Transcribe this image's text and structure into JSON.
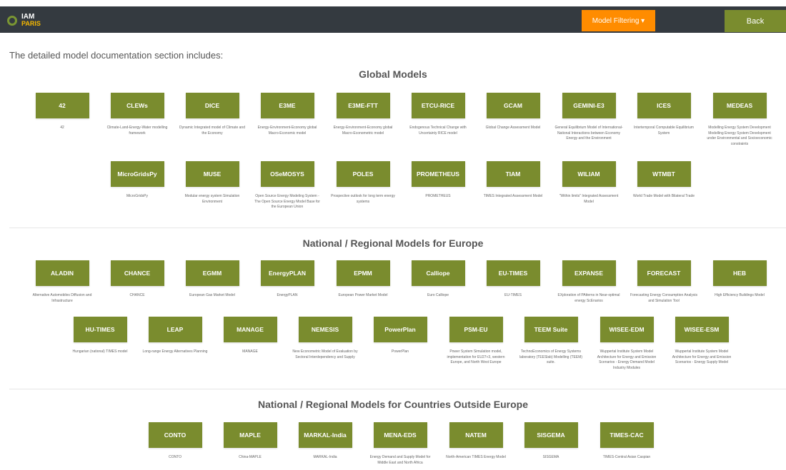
{
  "header": {
    "logo_line1": "IAM",
    "logo_line2": "PARIS",
    "filter_label": "Model Filtering ▾",
    "back_label": "Back"
  },
  "intro": "The detailed model documentation section includes:",
  "sections": [
    {
      "title": "Global Models",
      "models": [
        {
          "name": "42",
          "desc": "42"
        },
        {
          "name": "CLEWs",
          "desc": "Climate-Land-Energy-Water modelling framework"
        },
        {
          "name": "DICE",
          "desc": "Dynamic Integrated model of Climate and the Economy"
        },
        {
          "name": "E3ME",
          "desc": "Energy-Environment-Economy global Macro-Economic model"
        },
        {
          "name": "E3ME-FTT",
          "desc": "Energy-Environment-Economy global Macro-Econometric model"
        },
        {
          "name": "ETCU-RICE",
          "desc": "Endogenous Technical Change with Uncertainty RICE model"
        },
        {
          "name": "GCAM",
          "desc": "Global Change Assessment Model"
        },
        {
          "name": "GEMINI-E3",
          "desc": "General Equilibrium Model of International-National Interactions between Economy Energy and the Environment"
        },
        {
          "name": "ICES",
          "desc": "Intertemporal Computable Equilibrium System"
        },
        {
          "name": "MEDEAS",
          "desc": "Modelling Energy System Development Modelling Energy System Development under Environmental and Socioeconomic constraints"
        },
        {
          "name": "MicroGridsPy",
          "desc": "MicroGridsPy"
        },
        {
          "name": "MUSE",
          "desc": "Modular energy system Simulation Environment"
        },
        {
          "name": "OSeMOSYS",
          "desc": "Open Source Energy Modeling System - The Open Source Energy Model Base for the European Union"
        },
        {
          "name": "POLES",
          "desc": "Prospective outlook for long term energy systems"
        },
        {
          "name": "PROMETHEUS",
          "desc": "PROMETHEUS"
        },
        {
          "name": "TIAM",
          "desc": "TIMES Integrated Assessment Model"
        },
        {
          "name": "WILIAM",
          "desc": "\"Within limits\" Integrated Assessment Model"
        },
        {
          "name": "WTMBT",
          "desc": "World Trade Model with Bilateral Trade"
        }
      ]
    },
    {
      "title": "National / Regional Models for Europe",
      "models": [
        {
          "name": "ALADIN",
          "desc": "Alternative Automobiles Diffusion and Infrastructure"
        },
        {
          "name": "CHANCE",
          "desc": "CHANCE"
        },
        {
          "name": "EGMM",
          "desc": "European Gas Market Model"
        },
        {
          "name": "EnergyPLAN",
          "desc": "EnergyPLAN"
        },
        {
          "name": "EPMM",
          "desc": "European Power Market Model"
        },
        {
          "name": "Calliope",
          "desc": "Euro Calliope"
        },
        {
          "name": "EU-TIMES",
          "desc": "EU-TIMES"
        },
        {
          "name": "EXPANSE",
          "desc": "EXploration of PAtterns in Near-optimal energy ScEnarios"
        },
        {
          "name": "FORECAST",
          "desc": "Forecasting Energy Consumption Analysis and Simulation Tool"
        },
        {
          "name": "HEB",
          "desc": "High Efficiency Buildings Model"
        },
        {
          "name": "HU-TIMES",
          "desc": "Hungarian (national) TIMES model"
        },
        {
          "name": "LEAP",
          "desc": "Long-range Energy Alternatives Planning"
        },
        {
          "name": "MANAGE",
          "desc": "MANAGE"
        },
        {
          "name": "NEMESIS",
          "desc": "New Econometric Model of Evaluation by Sectoral Interdependency and Supply"
        },
        {
          "name": "PowerPlan",
          "desc": "PowerPlan"
        },
        {
          "name": "PSM-EU",
          "desc": "Power System Simulation model, implementation for EU27+3, western Europe, and North West Europe"
        },
        {
          "name": "TEEM Suite",
          "desc": "TechnoEconomics of Energy Systems laboratory (TEESlab) Modelling (TEEM) suite."
        },
        {
          "name": "WISEE-EDM",
          "desc": "Wuppertal Institute System Model Architecture for Energy and Emission Scenarios - Energy Demand Model Industry Modules"
        },
        {
          "name": "WISEE-ESM",
          "desc": "Wuppertal Institute System Model Architecture for Energy and Emission Scenarios - Energy Supply Model"
        }
      ]
    },
    {
      "title": "National / Regional Models for Countries Outside Europe",
      "models": [
        {
          "name": "CONTO",
          "desc": "CONTO"
        },
        {
          "name": "MAPLE",
          "desc": "China-MAPLE"
        },
        {
          "name": "MARKAL-India",
          "desc": "MARKAL-India"
        },
        {
          "name": "MENA-EDS",
          "desc": "Energy Demand and Supply Model for Middle East and North Africa"
        },
        {
          "name": "NATEM",
          "desc": "North-American TIMES Energy Model"
        },
        {
          "name": "SISGEMA",
          "desc": "SISGEMA"
        },
        {
          "name": "TIMES-CAC",
          "desc": "TIMES-Central Asian Caspian"
        }
      ]
    }
  ],
  "colors": {
    "accent": "#7a8c2e",
    "filter": "#ff8c00",
    "topbar": "#343a40"
  }
}
